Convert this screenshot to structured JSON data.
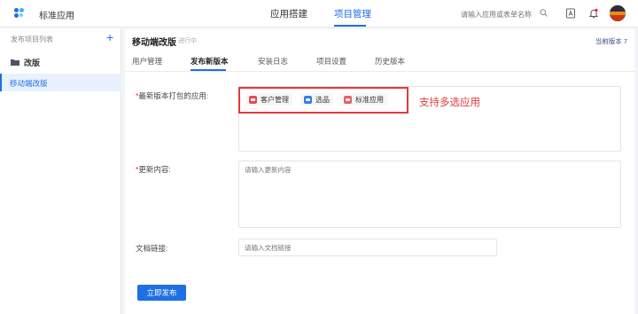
{
  "header": {
    "app_title": "标准应用",
    "nav": [
      "应用搭建",
      "项目管理"
    ],
    "active_nav": "项目管理",
    "search_placeholder": "请输入应用或表单名称",
    "icons": [
      "search-icon",
      "help-icon",
      "bell-icon",
      "avatar"
    ],
    "accent": "#1f6fe5"
  },
  "sidebar": {
    "header": "发布项目列表",
    "add_label": "+",
    "folder": "改版",
    "selected_item": "移动端改版"
  },
  "main": {
    "title": "移动端改版",
    "tag": "进行中",
    "version": "当前版本 7",
    "tabs": [
      "用户管理",
      "发布新版本",
      "安装日志",
      "项目设置",
      "历史版本"
    ],
    "active_tab": "发布新版本",
    "form": {
      "apps_label": "最新版本打包的应用:",
      "apps": [
        {
          "name": "客户管理",
          "color": "#e84a4a"
        },
        {
          "name": "选品",
          "color": "#2f7fe6"
        },
        {
          "name": "标准应用",
          "color": "#e86060"
        }
      ],
      "annotation": "支持多选应用",
      "content_label": "更新内容:",
      "content_placeholder": "请输入更新内容",
      "link_label": "文档链接:",
      "link_placeholder": "请输入文档链接",
      "required_mark": "*",
      "submit": "立即发布"
    },
    "highlight_color": "#e13a3a"
  }
}
